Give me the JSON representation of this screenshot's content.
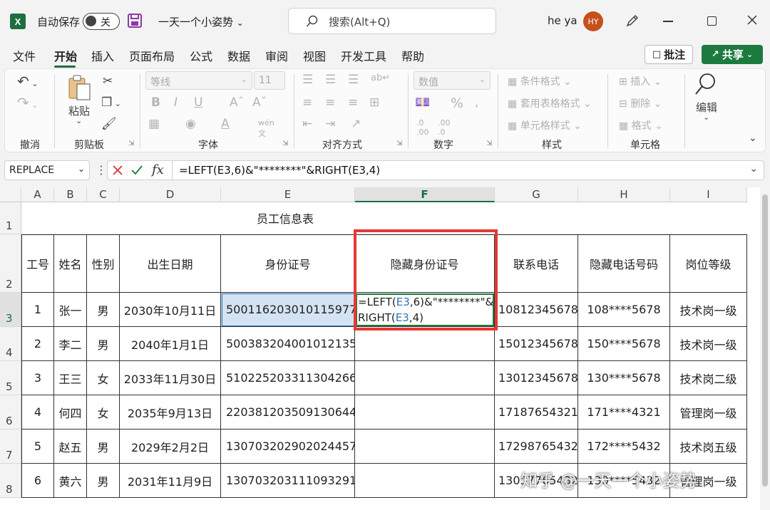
{
  "titlebar": {
    "app_icon": "X",
    "autosave_label": "自动保存",
    "autosave_state": "关",
    "doc_title": "一天一个小姿势",
    "search_placeholder": "搜索(Alt+Q)",
    "user_name": "he ya",
    "user_initials": "HY"
  },
  "menu": {
    "items": [
      "文件",
      "开始",
      "插入",
      "页面布局",
      "公式",
      "数据",
      "审阅",
      "视图",
      "开发工具",
      "帮助"
    ],
    "active": "开始",
    "comment_label": "批注",
    "share_label": "共享"
  },
  "ribbon": {
    "groups": [
      "撤消",
      "剪贴板",
      "字体",
      "对齐方式",
      "数字",
      "样式",
      "单元格"
    ],
    "paste_label": "粘贴",
    "font_name_placeholder": "等线",
    "font_size_placeholder": "11",
    "number_format_placeholder": "数值",
    "conditional_format": "条件格式",
    "table_format": "套用表格格式",
    "cell_style": "单元格样式",
    "insert": "插入",
    "delete": "删除",
    "format": "格式",
    "edit_label": "编辑"
  },
  "formula_bar": {
    "name_box": "REPLACE",
    "formula": "=LEFT(E3,6)&\"********\"&RIGHT(E3,4)"
  },
  "sheet": {
    "columns": [
      "A",
      "B",
      "C",
      "D",
      "E",
      "F",
      "G",
      "H",
      "I"
    ],
    "rows": [
      "1",
      "2",
      "3",
      "4",
      "5",
      "6",
      "7",
      "8"
    ],
    "title": "员工信息表",
    "headers": [
      "工号",
      "姓名",
      "性别",
      "出生日期",
      "身份证号",
      "隐藏身份证号",
      "联系电话",
      "隐藏电话号码",
      "岗位等级"
    ],
    "editing_cell": {
      "line1_pre": "=LEFT(",
      "line1_ref": "E3",
      "line1_post": ",6)&\"********\"&",
      "line2_pre": "RIGHT(",
      "line2_ref": "E3",
      "line2_post": ",4)"
    },
    "data": [
      [
        "1",
        "张一",
        "男",
        "2030年10月11日",
        "500116203010115977",
        "",
        "10812345678",
        "108****5678",
        "技术岗一级"
      ],
      [
        "2",
        "李二",
        "男",
        "2040年1月1日",
        "500383204001012135",
        "",
        "15012345678",
        "150****5678",
        "技术岗一级"
      ],
      [
        "3",
        "王三",
        "女",
        "2033年11月30日",
        "510225203311304266",
        "",
        "13012345678",
        "130****5678",
        "技术岗二级"
      ],
      [
        "4",
        "何四",
        "女",
        "2035年9月13日",
        "220381203509130644",
        "",
        "17187654321",
        "171****4321",
        "管理岗一级"
      ],
      [
        "5",
        "赵五",
        "男",
        "2029年2月2日",
        "130703202902024457",
        "",
        "17298765432",
        "172****5432",
        "技术岗五级"
      ],
      [
        "6",
        "黄六",
        "男",
        "2031年11月9日",
        "130703203111093291",
        "",
        "13057765432",
        "130****5432",
        "管理岗一级"
      ]
    ],
    "ref_color": "#2e75b6",
    "highlight_color": "#e53935"
  },
  "watermark": "知乎 @一天一个小姿势"
}
